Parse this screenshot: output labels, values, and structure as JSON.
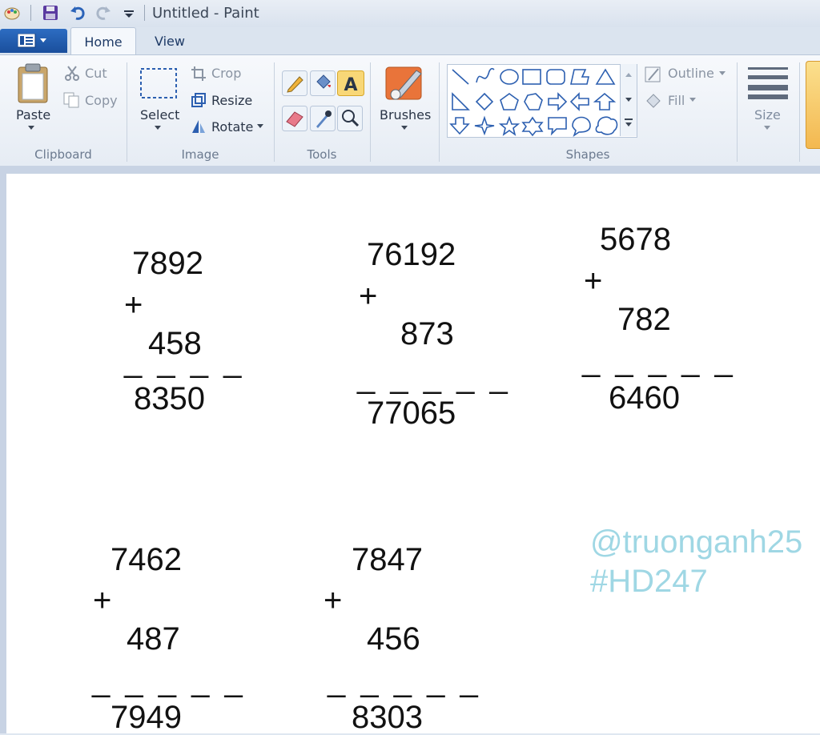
{
  "window": {
    "title": "Untitled - Paint"
  },
  "tabs": [
    {
      "label": "Home"
    },
    {
      "label": "View"
    }
  ],
  "ribbon": {
    "clipboard": {
      "paste": "Paste",
      "cut": "Cut",
      "copy": "Copy",
      "label": "Clipboard"
    },
    "image": {
      "select": "Select",
      "crop": "Crop",
      "resize": "Resize",
      "rotate": "Rotate",
      "label": "Image"
    },
    "tools": {
      "label": "Tools"
    },
    "brushes": {
      "label": "Brushes"
    },
    "shapes": {
      "outline": "Outline",
      "fill": "Fill",
      "label": "Shapes"
    },
    "size": {
      "label": "Size"
    }
  },
  "canvas": {
    "problems": [
      {
        "a": "7892",
        "op": "+",
        "b": "458",
        "line": "_ _ _ _",
        "result": "8350"
      },
      {
        "a": "76192",
        "op": "+",
        "b": "873",
        "line": "_ _ _ _ _",
        "result": "77065"
      },
      {
        "a": "5678",
        "op": "+",
        "b": "782",
        "line": "_ _ _ _ _",
        "result": "6460"
      },
      {
        "a": "7462",
        "op": "+",
        "b": "487",
        "line": "_ _ _ _ _",
        "result": "7949"
      },
      {
        "a": "7847",
        "op": "+",
        "b": "456",
        "line": "_ _ _ _ _",
        "result": "8303"
      }
    ],
    "watermark": {
      "line1": "@truonganh25",
      "line2": "#HD247"
    }
  }
}
